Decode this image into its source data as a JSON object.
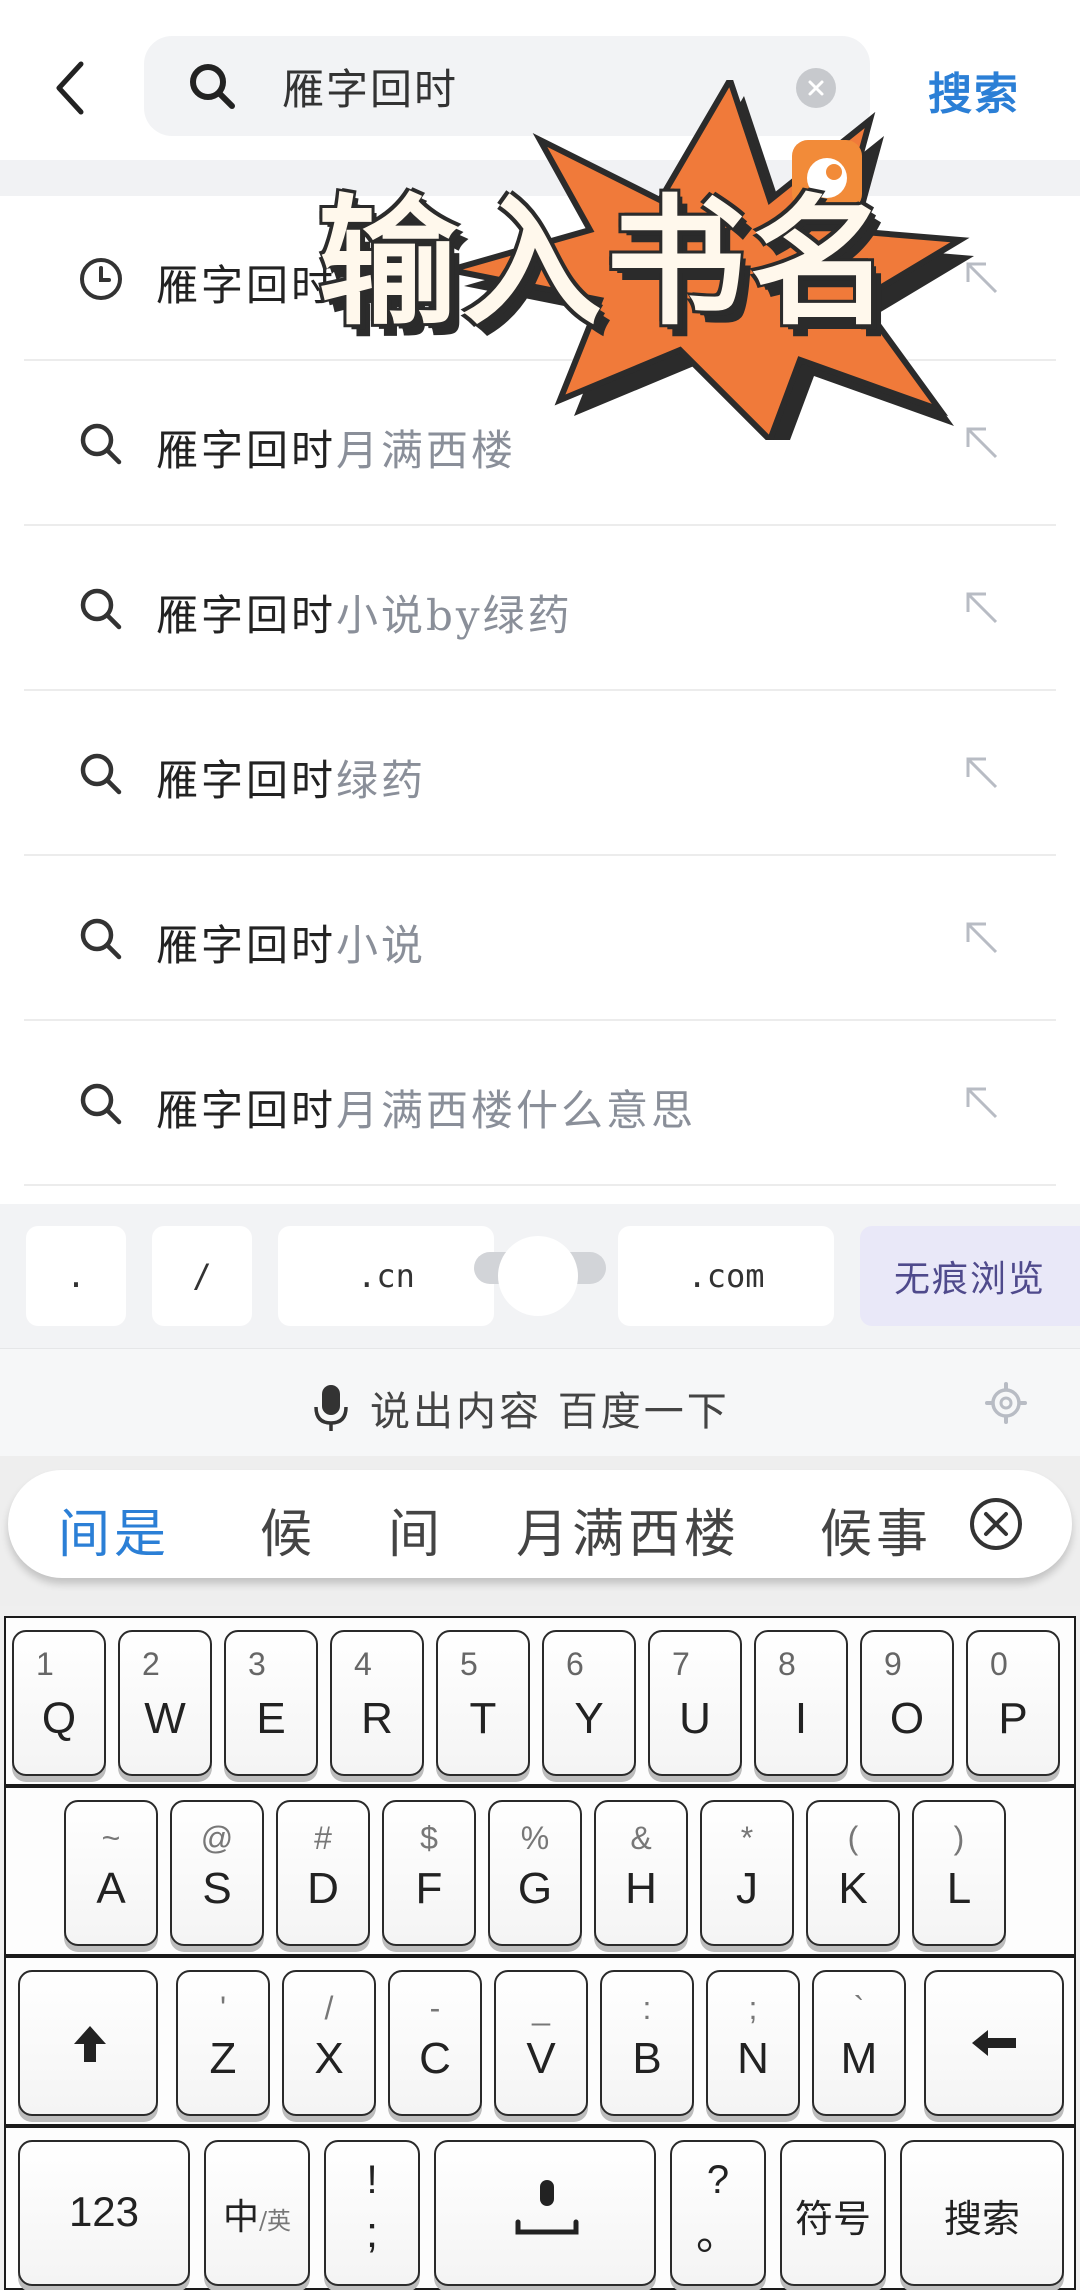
{
  "header": {
    "back_icon": "chevron-left-icon",
    "search_icon": "search-icon",
    "query": "雁字回时",
    "clear_icon": "clear-icon",
    "submit_label": "搜索"
  },
  "overlay": {
    "title": "输入书名",
    "badge_icon": "app-logo-icon"
  },
  "suggestions": [
    {
      "icon": "history-clock-icon",
      "base": "雁字回时",
      "rest": ""
    },
    {
      "icon": "search-icon",
      "base": "雁字回时",
      "rest": "月满西楼"
    },
    {
      "icon": "search-icon",
      "base": "雁字回时",
      "rest": "小说by绿药"
    },
    {
      "icon": "search-icon",
      "base": "雁字回时",
      "rest": "绿药"
    },
    {
      "icon": "search-icon",
      "base": "雁字回时",
      "rest": "小说"
    },
    {
      "icon": "search-icon",
      "base": "雁字回时",
      "rest": "月满西楼什么意思"
    }
  ],
  "shortcut_bar": {
    "keys": [
      ".",
      "/",
      ".cn",
      ".com"
    ],
    "incognito_label": "无痕浏览"
  },
  "voice_bar": {
    "mic_icon": "microphone-icon",
    "label": "说出内容 百度一下",
    "settings_icon": "gear-icon"
  },
  "candidates": {
    "items": [
      "间是",
      "候",
      "间",
      "月满西楼",
      "候事"
    ],
    "close_icon": "close-circle-icon"
  },
  "keyboard": {
    "row1": [
      {
        "num": "1",
        "ltr": "Q"
      },
      {
        "num": "2",
        "ltr": "W"
      },
      {
        "num": "3",
        "ltr": "E"
      },
      {
        "num": "4",
        "ltr": "R"
      },
      {
        "num": "5",
        "ltr": "T"
      },
      {
        "num": "6",
        "ltr": "Y"
      },
      {
        "num": "7",
        "ltr": "U"
      },
      {
        "num": "8",
        "ltr": "I"
      },
      {
        "num": "9",
        "ltr": "O"
      },
      {
        "num": "0",
        "ltr": "P"
      }
    ],
    "row2": [
      {
        "sym": "~",
        "ltr": "A"
      },
      {
        "sym": "@",
        "ltr": "S"
      },
      {
        "sym": "#",
        "ltr": "D"
      },
      {
        "sym": "$",
        "ltr": "F"
      },
      {
        "sym": "%",
        "ltr": "G"
      },
      {
        "sym": "&",
        "ltr": "H"
      },
      {
        "sym": "*",
        "ltr": "J"
      },
      {
        "sym": "(",
        "ltr": "K"
      },
      {
        "sym": ")",
        "ltr": "L"
      }
    ],
    "row3": [
      {
        "sym": "'",
        "ltr": "Z"
      },
      {
        "sym": "/",
        "ltr": "X"
      },
      {
        "sym": "-",
        "ltr": "C"
      },
      {
        "sym": "_",
        "ltr": "V"
      },
      {
        "sym": ":",
        "ltr": "B"
      },
      {
        "sym": ";",
        "ltr": "N"
      },
      {
        "sym": "`",
        "ltr": "M"
      }
    ],
    "shift_icon": "shift-up-arrow-icon",
    "backspace_icon": "backspace-arrow-icon",
    "num_label": "123",
    "lang_main": "中",
    "lang_sub": "/英",
    "punct_top": "!",
    "punct_bottom": ";",
    "space_icon": "voice-space-icon",
    "q_top": "?",
    "q_bottom": "。",
    "symbols_label": "符号",
    "enter_label": "搜索"
  }
}
